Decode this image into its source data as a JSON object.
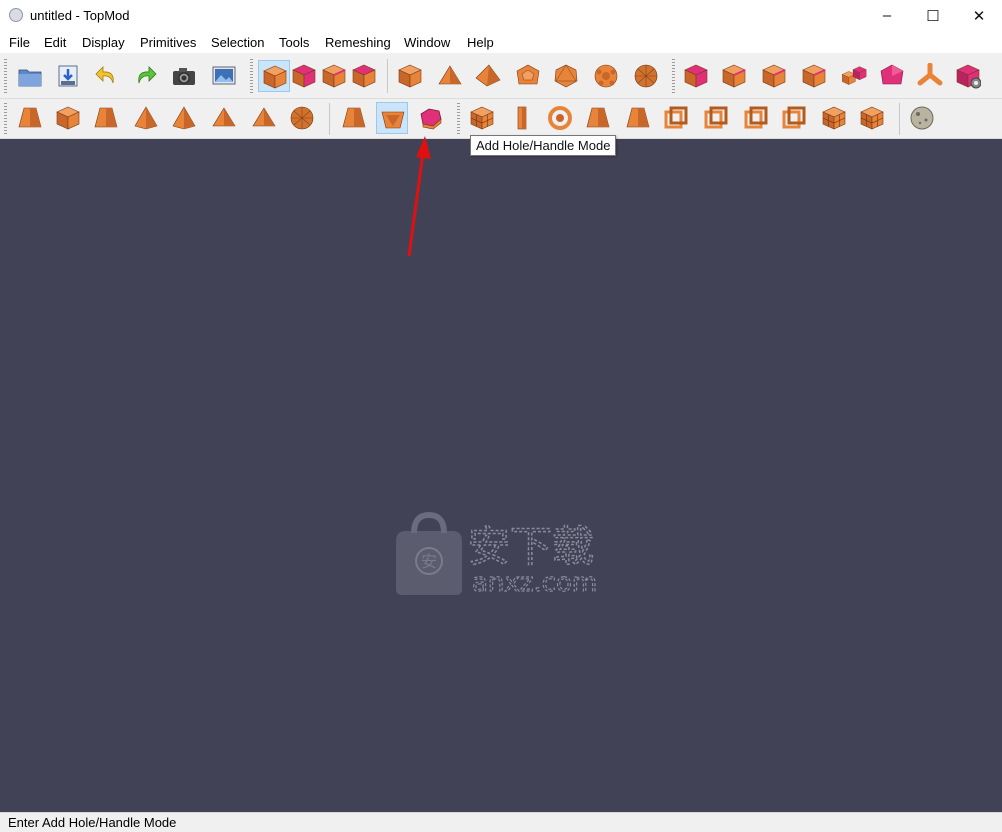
{
  "window": {
    "title": "untitled - TopMod"
  },
  "menu": [
    "File",
    "Edit",
    "Display",
    "Primitives",
    "Selection",
    "Tools",
    "Remeshing",
    "Window",
    "Help"
  ],
  "toolbar1": [
    {
      "name": "open-icon"
    },
    {
      "name": "save-icon"
    },
    {
      "name": "undo-icon"
    },
    {
      "name": "redo-icon"
    },
    {
      "name": "camera-icon"
    },
    {
      "name": "screenshot-icon"
    },
    {
      "name": "select-object-mode-icon",
      "active": true
    },
    {
      "name": "select-face-mode-icon"
    },
    {
      "name": "select-edge-mode-icon"
    },
    {
      "name": "select-vertex-mode-icon"
    },
    {
      "name": "cube-primitive-icon"
    },
    {
      "name": "tetrahedron-primitive-icon"
    },
    {
      "name": "octahedron-primitive-icon"
    },
    {
      "name": "dodecahedron-primitive-icon"
    },
    {
      "name": "icosahedron-primitive-icon"
    },
    {
      "name": "soccerball-primitive-icon"
    },
    {
      "name": "geodesic-primitive-icon"
    },
    {
      "name": "insert-edge-icon"
    },
    {
      "name": "delete-edge-icon"
    },
    {
      "name": "collapse-edge-icon"
    },
    {
      "name": "subdivide-edge-icon"
    },
    {
      "name": "connect-edges-icon"
    },
    {
      "name": "transform-icon"
    },
    {
      "name": "extrude-vertex-icon"
    },
    {
      "name": "settings-cube-icon"
    }
  ],
  "toolbar2": [
    {
      "name": "extrude-face-icon"
    },
    {
      "name": "extrude-dual-icon"
    },
    {
      "name": "extrude-dodeca-icon"
    },
    {
      "name": "extrude-icosa-icon"
    },
    {
      "name": "extrude-octa-icon"
    },
    {
      "name": "stellate-icon"
    },
    {
      "name": "double-stellate-icon"
    },
    {
      "name": "sphere-mesh-icon"
    },
    {
      "name": "add-handle-icon"
    },
    {
      "name": "conical-mode-icon",
      "active": true
    },
    {
      "name": "add-hole-handle-icon"
    },
    {
      "name": "rind-modeling-icon"
    },
    {
      "name": "pillar-icon"
    },
    {
      "name": "spiral-icon"
    },
    {
      "name": "sculpt-icon"
    },
    {
      "name": "crust-icon"
    },
    {
      "name": "wireframe-icon"
    },
    {
      "name": "column-wireframe-icon"
    },
    {
      "name": "sierpinsky-icon"
    },
    {
      "name": "multi-face-handle-icon"
    },
    {
      "name": "menger-sponge-icon"
    },
    {
      "name": "grid-cube-icon"
    },
    {
      "name": "texture-sphere-icon"
    }
  ],
  "tooltip": "Add Hole/Handle Mode",
  "status": "Enter Add Hole/Handle Mode",
  "watermark": {
    "cn": "安下载",
    "site": "anxz.com"
  },
  "colors": {
    "orange": "#e8843a",
    "magenta": "#e0307a",
    "viewport": "#424256",
    "arrow": "#e01010"
  }
}
